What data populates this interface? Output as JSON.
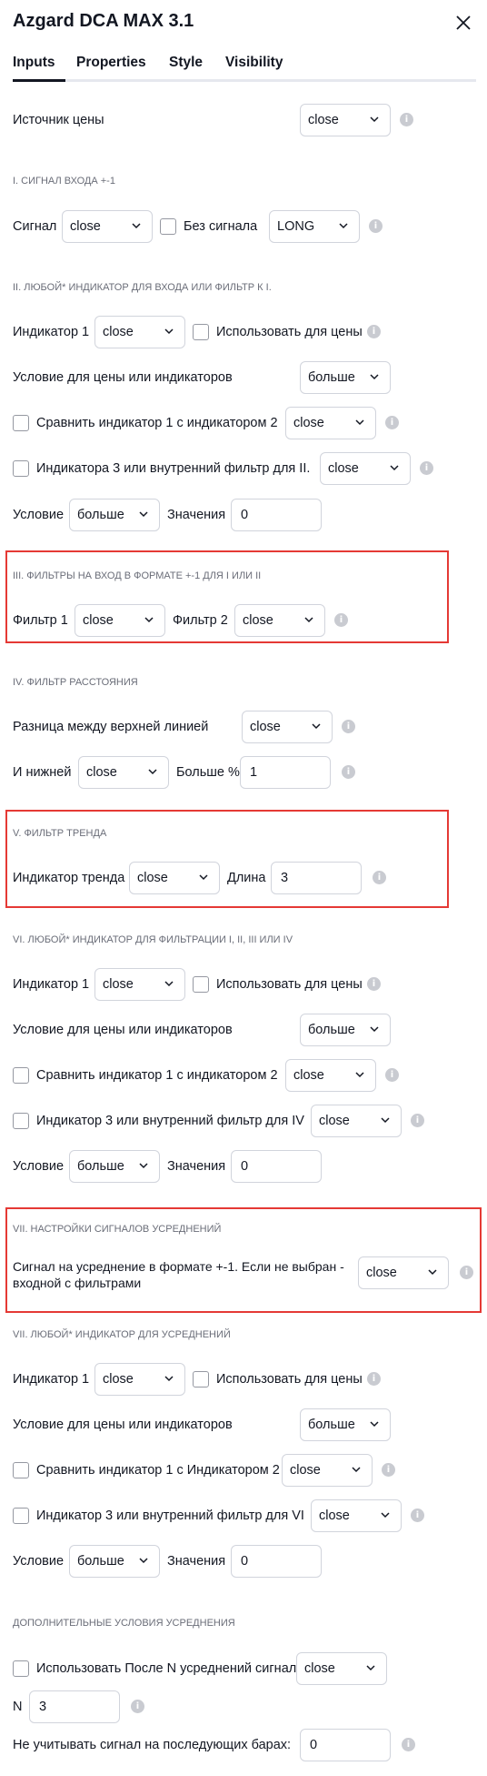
{
  "dialog": {
    "title": "Azgard DCA MAX 3.1",
    "tabs": [
      "Inputs",
      "Properties",
      "Style",
      "Visibility"
    ],
    "active_tab": "Inputs"
  },
  "price_source": {
    "label": "Источник цены",
    "value": "close"
  },
  "s1": {
    "header": "I. СИГНАЛ ВХОДА +-1",
    "signal_label": "Сигнал",
    "signal_value": "close",
    "nosignal_label": "Без сигнала",
    "direction_value": "LONG"
  },
  "s2": {
    "header": "II. ЛЮБОЙ* ИНДИКАТОР ДЛЯ ВХОДА ИЛИ ФИЛЬТР К I.",
    "ind1_label": "Индикатор 1",
    "ind1_value": "close",
    "use_price_label": "Использовать для цены",
    "cond_label": "Условие для цены или индикаторов",
    "cond_value": "больше",
    "compare_label": "Сравнить индикатор 1 с индикатором 2",
    "compare_value": "close",
    "ind3_label": "Индикатора 3 или внутренний фильтр для II.",
    "ind3_value": "close",
    "condition_label": "Условие",
    "condition_value": "больше",
    "values_label": "Значения",
    "values_value": "0"
  },
  "s3": {
    "header": "III. ФИЛЬТРЫ НА ВХОД В ФОРМАТЕ +-1 ДЛЯ I ИЛИ II",
    "f1_label": "Фильтр 1",
    "f1_value": "close",
    "f2_label": "Фильтр 2",
    "f2_value": "close"
  },
  "s4": {
    "header": "IV. ФИЛЬТР РАССТОЯНИЯ",
    "diff_label": "Разница между верхней линией",
    "diff_value": "close",
    "lower_label": "И нижней",
    "lower_value": "close",
    "more_label": "Больше %",
    "more_value": "1"
  },
  "s5": {
    "header": "V. ФИЛЬТР ТРЕНДА",
    "trend_label": "Индикатор тренда",
    "trend_value": "close",
    "len_label": "Длина",
    "len_value": "3"
  },
  "s6": {
    "header": "VI. ЛЮБОЙ* ИНДИКАТОР ДЛЯ ФИЛЬТРАЦИИ I, II, III ИЛИ IV",
    "ind1_label": "Индикатор 1",
    "ind1_value": "close",
    "use_price_label": "Использовать для цены",
    "cond_label": "Условие для цены или индикаторов",
    "cond_value": "больше",
    "compare_label": "Сравнить индикатор 1 с индикатором 2",
    "compare_value": "close",
    "ind3_label": "Индикатор 3 или внутренний фильтр для IV",
    "ind3_value": "close",
    "condition_label": "Условие",
    "condition_value": "больше",
    "values_label": "Значения",
    "values_value": "0"
  },
  "s7": {
    "header": "VII. НАСТРОЙКИ СИГНАЛОВ УСРЕДНЕНИЙ",
    "signal_label": "Сигнал на усреднение в формате +-1. Если не выбран - входной с фильтрами",
    "signal_value": "close"
  },
  "s8": {
    "header": "VII. ЛЮБОЙ* ИНДИКАТОР ДЛЯ УСРЕДНЕНИЙ",
    "ind1_label": "Индикатор 1",
    "ind1_value": "close",
    "use_price_label": "Использовать для цены",
    "cond_label": "Условие для цены или индикаторов",
    "cond_value": "больше",
    "compare_label": "Сравнить индикатор 1 с  Индикатором 2",
    "compare_value": "close",
    "ind3_label": "Индикатор 3 или внутренний фильтр для VI",
    "ind3_value": "close",
    "condition_label": "Условие",
    "condition_value": "больше",
    "values_label": "Значения",
    "values_value": "0"
  },
  "s9": {
    "header": "ДОПОЛНИТЕЛЬНЫЕ УСЛОВИЯ УСРЕДНЕНИЯ",
    "use_label": "Использовать  После N усреднений сигнал",
    "use_value": "close",
    "n_label": "N",
    "n_value": "3",
    "ignore_label": "Не учитывать сигнал на последующих барах:",
    "ignore_value": "0"
  },
  "icons": {
    "close": "close-icon",
    "chevron": "chevron-down-icon",
    "info": "info-icon"
  },
  "colors": {
    "highlight": "#e53935",
    "text": "#131722",
    "muted": "#6a6d78",
    "border": "#d1d4dc"
  }
}
